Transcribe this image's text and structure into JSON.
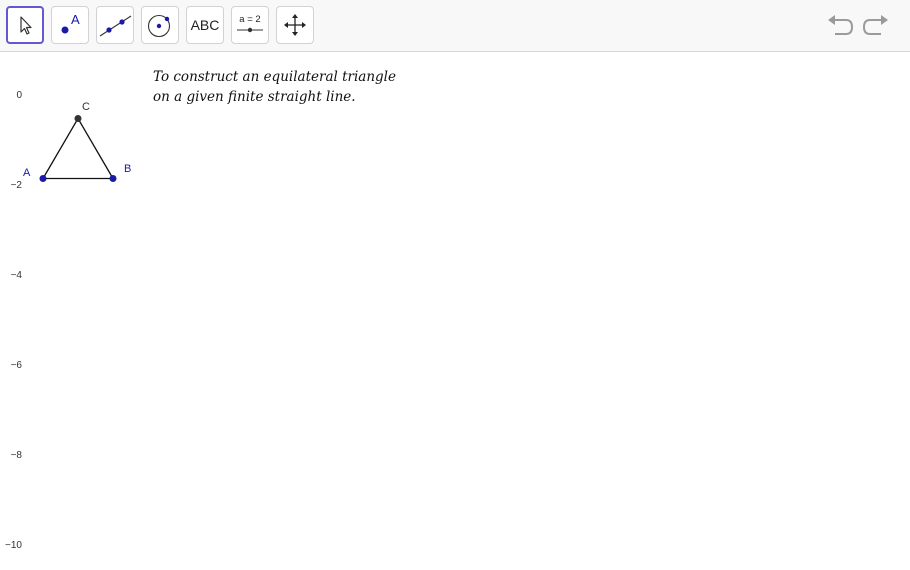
{
  "toolbar": {
    "tools": [
      {
        "icon": "move-pointer-icon",
        "selected": true
      },
      {
        "icon": "point-icon",
        "label": "A"
      },
      {
        "icon": "line-icon"
      },
      {
        "icon": "circle-icon"
      },
      {
        "icon": "text-icon",
        "label": "ABC"
      },
      {
        "icon": "slider-icon",
        "label": "a = 2"
      },
      {
        "icon": "move-graphics-view-icon"
      }
    ],
    "undo_icon": "undo-icon",
    "redo_icon": "redo-icon",
    "accent_color": "#6557d2"
  },
  "graphics": {
    "text": {
      "line1": "To construct an equilateral triangle",
      "line2": "on a given finite straight line."
    },
    "y_axis_labels": [
      "0",
      "−2",
      "−4",
      "−6",
      "−8",
      "−10"
    ],
    "points": {
      "A": {
        "label": "A",
        "color": "#1a1aa6"
      },
      "B": {
        "label": "B",
        "color": "#1a1aa6"
      },
      "C": {
        "label": "C",
        "color": "#333333"
      }
    }
  }
}
